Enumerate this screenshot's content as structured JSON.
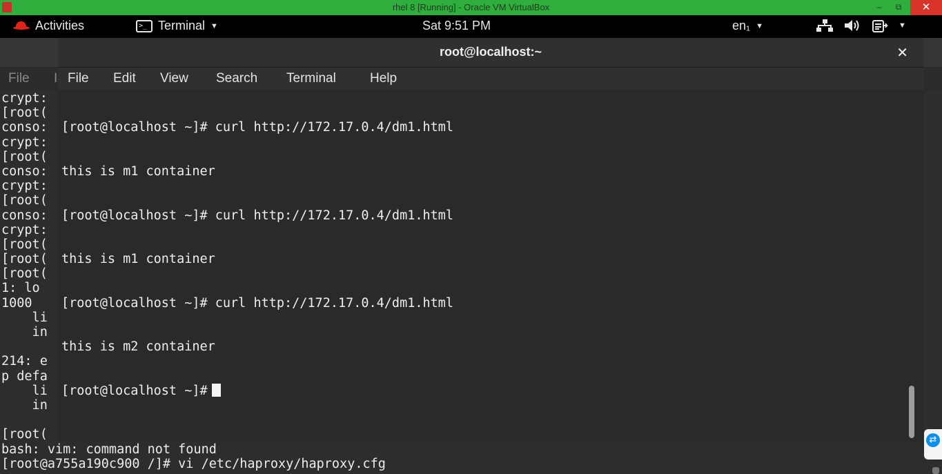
{
  "vbox": {
    "title": "rhel 8  [Running] - Oracle VM VirtualBox",
    "min": "‒",
    "restore": "⧉",
    "close": "✕"
  },
  "topbar": {
    "activities": "Activities",
    "app": "Terminal",
    "clock": "Sat  9:51 PM",
    "lang": "en₁",
    "caret": "▼"
  },
  "back_term": {
    "menu": [
      "File",
      "I"
    ],
    "lines": [
      "crypt:",
      "[root(",
      "conso:",
      "crypt:",
      "[root(",
      "conso:",
      "crypt:",
      "[root(",
      "conso:",
      "crypt:",
      "[root(",
      "[root(",
      "[root(",
      "1: lo",
      "1000",
      "    li",
      "    in",
      "",
      "214: e",
      "p defa",
      "    li",
      "    in",
      "",
      "[root(",
      "bash: vim: command not found",
      "[root@a755a190c900 /]# vi /etc/haproxy/haproxy.cfg"
    ]
  },
  "front_term": {
    "title": "root@localhost:~",
    "close": "✕",
    "menu": {
      "file": "File",
      "edit": "Edit",
      "view": "View",
      "search": "Search",
      "terminal": "Terminal",
      "help": "Help"
    },
    "lines": [
      "[root@localhost ~]# curl http://172.17.0.4/dm1.html",
      "this is m1 container",
      "[root@localhost ~]# curl http://172.17.0.4/dm1.html",
      "this is m1 container",
      "[root@localhost ~]# curl http://172.17.0.4/dm1.html",
      "this is m2 container"
    ],
    "prompt": "[root@localhost ~]#"
  }
}
